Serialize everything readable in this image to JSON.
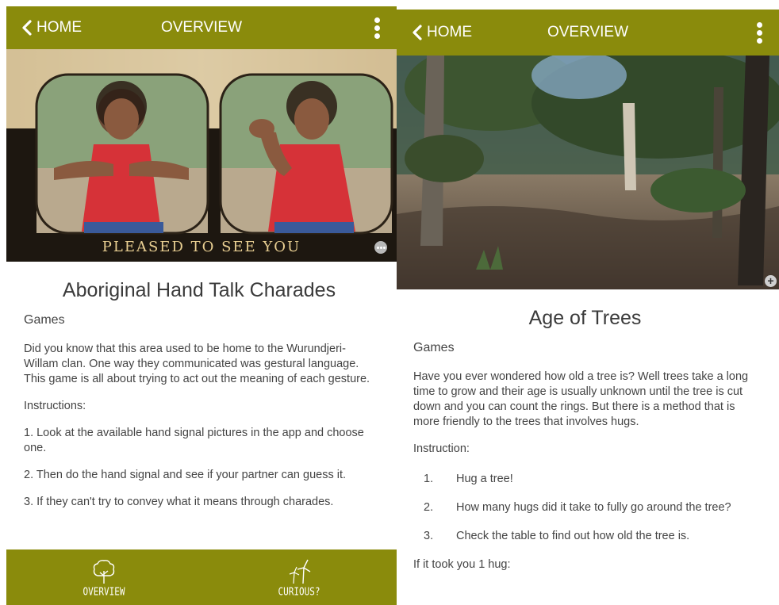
{
  "left": {
    "topbar": {
      "back_label": "HOME",
      "title": "OVERVIEW"
    },
    "hero": {
      "caption": "PLEASED TO SEE YOU"
    },
    "content": {
      "title": "Aboriginal Hand Talk Charades",
      "category": "Games",
      "intro": "Did you know that this area used to be home to the Wurundjeri-Willam clan. One way they communicated was gestural language. This game is all about trying to act out the meaning of each gesture.",
      "instructions_heading": "Instructions:",
      "steps": [
        "1. Look at the available hand signal pictures in the app and choose one.",
        "2. Then do the hand signal and see if your partner can guess it.",
        "3. If they can't try to convey what it means through charades."
      ]
    },
    "bottombar": {
      "tab_overview": "OVERVIEW",
      "tab_curious": "CURIOUS?"
    }
  },
  "right": {
    "topbar": {
      "back_label": "HOME",
      "title": "OVERVIEW"
    },
    "content": {
      "title": "Age of Trees",
      "category": "Games",
      "intro": "Have you ever wondered how old a tree is? Well trees take a long time to grow and their age is usually unknown until the tree is cut down and you can count the rings. But there is a method that is more friendly to the trees that involves hugs.",
      "instructions_heading": "Instruction:",
      "steps": [
        {
          "num": "1.",
          "text": "Hug a tree!"
        },
        {
          "num": "2.",
          "text": "How many hugs did it take to fully go around the tree?"
        },
        {
          "num": "3.",
          "text": "Check the table to find out how old the tree is."
        }
      ],
      "footer_text": "If it took you 1 hug:"
    }
  },
  "colors": {
    "brand": "#8a8b0c",
    "text": "#444444"
  },
  "icons": {
    "back": "chevron-left-icon",
    "menu": "more-vertical-icon",
    "overview_tab": "tree-icon",
    "curious_tab": "wind-turbine-icon"
  }
}
